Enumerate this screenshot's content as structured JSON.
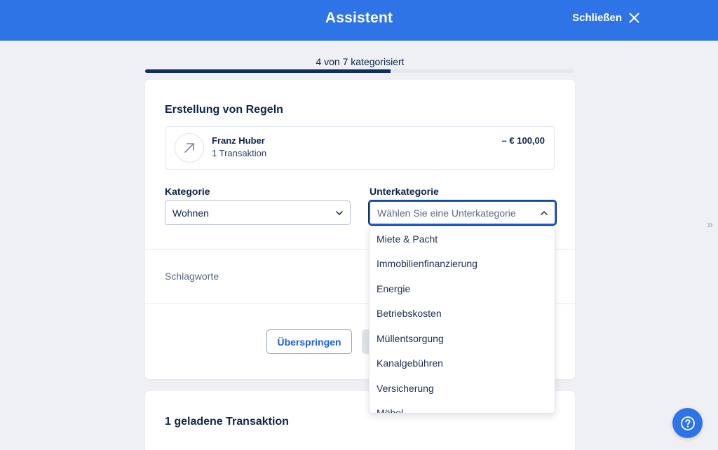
{
  "header": {
    "title": "Assistent",
    "close_label": "Schließen",
    "background_color": "#2f74e6"
  },
  "progress": {
    "label": "4 von 7 kategorisiert",
    "done": 4,
    "total": 7
  },
  "rule_card": {
    "title": "Erstellung von Regeln",
    "transaction": {
      "icon": "arrow-up-right-icon",
      "name": "Franz Huber",
      "count": "1 Transaktion",
      "amount": "– € 100,00"
    },
    "category": {
      "label": "Kategorie",
      "value": "Wohnen"
    },
    "subcategory": {
      "label": "Unterkategorie",
      "placeholder": "Wählen Sie eine Unterkategorie",
      "options": [
        "Miete & Pacht",
        "Immobilienfinanzierung",
        "Energie",
        "Betriebskosten",
        "Müllentsorgung",
        "Kanalgebühren",
        "Versicherung",
        "Möbel"
      ]
    },
    "tags_label": "Schlagworte",
    "skip_button": "Überspringen"
  },
  "loaded_card": {
    "title": "1 geladene Transaktion"
  },
  "accent_color": "#1e5fd6",
  "dark_color": "#0e2f66"
}
